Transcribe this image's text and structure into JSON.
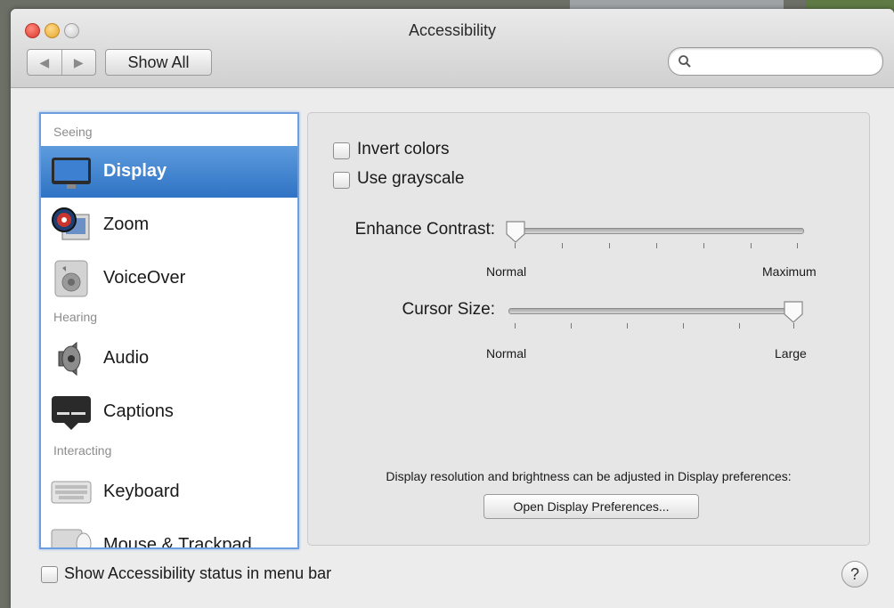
{
  "window": {
    "title": "Accessibility"
  },
  "toolbar": {
    "back_icon": "◀",
    "forward_icon": "▶",
    "show_all_label": "Show All",
    "search_placeholder": ""
  },
  "sidebar": {
    "sections": [
      {
        "heading": "Seeing"
      },
      {
        "heading": "Hearing"
      },
      {
        "heading": "Interacting"
      }
    ],
    "items": [
      {
        "label": "Display",
        "icon": "display-icon",
        "selected": true
      },
      {
        "label": "Zoom",
        "icon": "zoom-icon"
      },
      {
        "label": "VoiceOver",
        "icon": "voiceover-icon"
      },
      {
        "label": "Audio",
        "icon": "audio-icon"
      },
      {
        "label": "Captions",
        "icon": "captions-icon"
      },
      {
        "label": "Keyboard",
        "icon": "keyboard-icon"
      },
      {
        "label": "Mouse & Trackpad",
        "icon": "mouse-trackpad-icon"
      }
    ]
  },
  "display_pane": {
    "invert_colors": {
      "label": "Invert colors",
      "checked": false
    },
    "use_grayscale": {
      "label": "Use grayscale",
      "checked": false
    },
    "enhance_contrast": {
      "label": "Enhance Contrast:",
      "min_label": "Normal",
      "max_label": "Maximum",
      "value": 0
    },
    "cursor_size": {
      "label": "Cursor Size:",
      "min_label": "Normal",
      "max_label": "Large",
      "value": 1
    },
    "note": "Display resolution and brightness can be adjusted in Display preferences:",
    "open_button_label": "Open Display Preferences..."
  },
  "footer": {
    "status_label": "Show Accessibility status in menu bar",
    "status_checked": false,
    "help_label": "?"
  },
  "colors": {
    "selection": "#2f73c4",
    "focus_ring": "#6f9ee0"
  }
}
